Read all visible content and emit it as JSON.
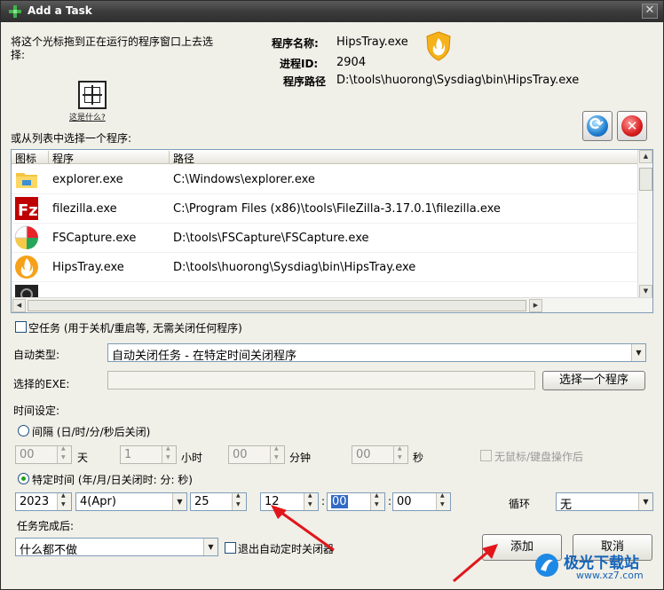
{
  "window": {
    "title": "Add a Task",
    "close_glyph": "✕"
  },
  "finder": {
    "instruction": "将这个光标拖到正在运行的程序窗口上去选择:",
    "whats_this": "这是什么?"
  },
  "info": {
    "name_label": "程序名称:",
    "name_value": "HipsTray.exe",
    "pid_label": "进程ID:",
    "pid_value": "2904",
    "path_label": "程序路径",
    "path_value": "D:\\tools\\huorong\\Sysdiag\\bin\\HipsTray.exe"
  },
  "list": {
    "section_label": "或从列表中选择一个程序:",
    "columns": [
      "图标",
      "程序",
      "路径"
    ],
    "rows": [
      {
        "name": "explorer.exe",
        "path": "C:\\Windows\\explorer.exe",
        "icon": "folder-icon"
      },
      {
        "name": "filezilla.exe",
        "path": "C:\\Program Files (x86)\\tools\\FileZilla-3.17.0.1\\filezilla.exe",
        "icon": "filezilla-icon"
      },
      {
        "name": "FSCapture.exe",
        "path": "D:\\tools\\FSCapture\\FSCapture.exe",
        "icon": "fscapture-icon"
      },
      {
        "name": "HipsTray.exe",
        "path": "D:\\tools\\huorong\\Sysdiag\\bin\\HipsTray.exe",
        "icon": "huorong-icon"
      }
    ]
  },
  "options": {
    "empty_task_label": "空任务 (用于关机/重启等, 无需关闭任何程序)",
    "auto_type_label": "自动类型:",
    "auto_type_value": "自动关闭任务 - 在特定时间关闭程序",
    "exe_label": "选择的EXE:",
    "exe_value": "",
    "choose_program_button": "选择一个程序"
  },
  "time": {
    "section_label": "时间设定:",
    "interval_label": "间隔 (日/时/分/秒后关闭)",
    "days_value": "00",
    "days_unit": "天",
    "hours_value": "1",
    "hours_unit": "小时",
    "minutes_value": "00",
    "minutes_unit": "分钟",
    "seconds_value": "00",
    "seconds_unit": "秒",
    "no_input_label": "无鼠标/键盘操作后",
    "specific_label": "特定时间 (年/月/日关闭时: 分: 秒)",
    "year": "2023",
    "month": "4(Apr)",
    "day": "25",
    "hour": "12",
    "minute": "00",
    "second": "00",
    "colon": ":",
    "loop_label": "循环",
    "loop_value": "无"
  },
  "complete": {
    "label": "任务完成后:",
    "action_value": "什么都不做",
    "exit_label": "退出自动定时关闭器"
  },
  "buttons": {
    "add": "添加",
    "cancel": "取消"
  },
  "watermark": {
    "text": "极光下载站",
    "url": "www.xz7.com"
  },
  "colors": {
    "arrow": "#e0161b",
    "accent": "#316ac5"
  }
}
